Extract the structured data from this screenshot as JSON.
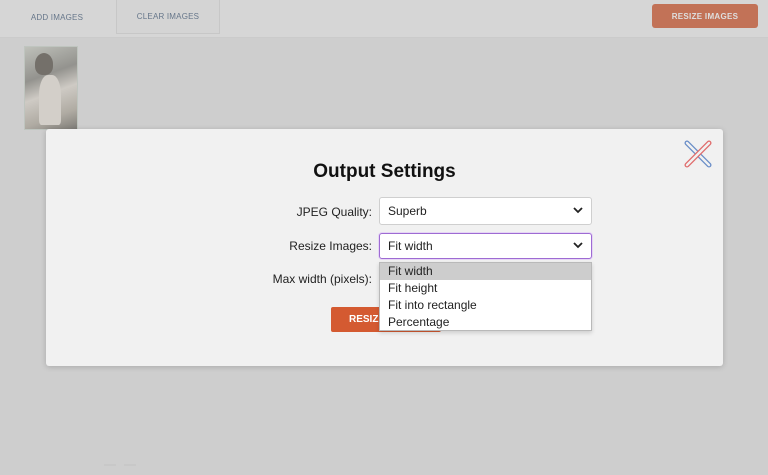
{
  "background": {
    "tabs": [
      {
        "label": "Add Images"
      },
      {
        "label": "Clear Images"
      }
    ],
    "resize_button_label": "Resize Images",
    "footer_links": [
      "",
      ""
    ]
  },
  "modal": {
    "title": "Output Settings",
    "close_icon": "close-x-icon",
    "fields": {
      "jpeg_quality": {
        "label": "JPEG Quality:",
        "value": "Superb"
      },
      "resize_images": {
        "label": "Resize Images:",
        "value": "Fit width"
      },
      "max_width": {
        "label": "Max width (pixels):"
      }
    },
    "resize_button_label": "RESIZE"
  },
  "dropdown": {
    "options": [
      "Fit width",
      "Fit height",
      "Fit into rectangle",
      "Percentage"
    ],
    "selected": "Fit width"
  },
  "colors": {
    "accent": "#d45a31",
    "focus": "#9e6bd3",
    "close_icon_a": "#e06b6b",
    "close_icon_b": "#6a8ec8"
  }
}
